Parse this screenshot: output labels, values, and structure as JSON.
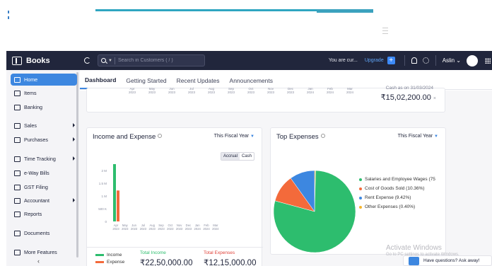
{
  "app": {
    "name": "Books"
  },
  "search": {
    "placeholder": "Search in Customers ( / )"
  },
  "header": {
    "org": "You are cur...",
    "upgrade": "Upgrade",
    "user": "Aslin",
    "user_caret": "⌄"
  },
  "sidebar": {
    "items": [
      {
        "label": "Home",
        "active": true
      },
      {
        "label": "Items"
      },
      {
        "label": "Banking"
      },
      {
        "label": "Sales",
        "has_submenu": true
      },
      {
        "label": "Purchases",
        "has_submenu": true
      },
      {
        "label": "Time Tracking",
        "has_submenu": true
      },
      {
        "label": "e-Way Bills"
      },
      {
        "label": "GST Filing"
      },
      {
        "label": "Accountant",
        "has_submenu": true
      },
      {
        "label": "Reports"
      },
      {
        "label": "Documents"
      },
      {
        "label": "More Features"
      }
    ],
    "collapse": "‹"
  },
  "tabs": [
    "Dashboard",
    "Getting Started",
    "Recent Updates",
    "Announcements"
  ],
  "cash_flow": {
    "months": [
      [
        "Apr",
        "2023"
      ],
      [
        "May",
        "2023"
      ],
      [
        "Jun",
        "2023"
      ],
      [
        "Jul",
        "2023"
      ],
      [
        "Aug",
        "2023"
      ],
      [
        "Sep",
        "2023"
      ],
      [
        "Oct",
        "2023"
      ],
      [
        "Nov",
        "2023"
      ],
      [
        "Dec",
        "2023"
      ],
      [
        "Jan",
        "2024"
      ],
      [
        "Feb",
        "2024"
      ],
      [
        "Mar",
        "2024"
      ]
    ],
    "cash_label": "Cash as on 31/03/2024",
    "cash_value": "₹15,02,200.00",
    "close": "×"
  },
  "income_expense": {
    "title": "Income and Expense",
    "period": "This Fiscal Year",
    "toggle": [
      "Accrual",
      "Cash"
    ],
    "legend": [
      {
        "label": "Income",
        "color": "#2dbd6e"
      },
      {
        "label": "Expense",
        "color": "#f36a3b"
      }
    ],
    "total_income_label": "Total Income",
    "total_income": "₹22,50,000.00",
    "total_expenses_label": "Total Expenses",
    "total_expenses": "₹12,15,000.00"
  },
  "chart_data": [
    {
      "type": "bar",
      "title": "Income and Expense",
      "categories": [
        "Apr 2023",
        "May 2023",
        "Jun 2023",
        "Jul 2023",
        "Aug 2023",
        "Sep 2023",
        "Oct 2023",
        "Nov 2023",
        "Dec 2023",
        "Jan 2024",
        "Feb 2024",
        "Mar 2024"
      ],
      "category_labels": [
        [
          "Apr",
          "2023"
        ],
        [
          "May",
          "2023"
        ],
        [
          "Jun",
          "2023"
        ],
        [
          "Jul",
          "2023"
        ],
        [
          "Aug",
          "2023"
        ],
        [
          "Sep",
          "2023"
        ],
        [
          "Oct",
          "2023"
        ],
        [
          "Nov",
          "2023"
        ],
        [
          "Dec",
          "2023"
        ],
        [
          "Jan",
          "2024"
        ],
        [
          "Feb",
          "2024"
        ],
        [
          "Mar",
          "2024"
        ]
      ],
      "series": [
        {
          "name": "Income",
          "color": "#2dbd6e",
          "values": [
            2250000,
            0,
            0,
            0,
            0,
            0,
            0,
            0,
            0,
            0,
            0,
            0
          ]
        },
        {
          "name": "Expense",
          "color": "#f36a3b",
          "values": [
            1215000,
            0,
            0,
            0,
            0,
            0,
            0,
            0,
            0,
            0,
            0,
            0
          ]
        }
      ],
      "yticks": [
        "0",
        "500 K",
        "1 M",
        "1.5 M",
        "2 M"
      ],
      "ylim": [
        0,
        2000000
      ]
    },
    {
      "type": "pie",
      "title": "Top Expenses",
      "slices": [
        {
          "label": "Salaries and Employee Wages (75",
          "value": 75,
          "color": "#2dbd6e"
        },
        {
          "label": "Cost of Goods Sold (10.36%)",
          "value": 10.36,
          "color": "#f36a3b"
        },
        {
          "label": "Rent Expense (9.42%)",
          "value": 9.42,
          "color": "#3d87e0"
        },
        {
          "label": "Other Expenses (0.40%)",
          "value": 0.4,
          "color": "#f5b52e"
        }
      ]
    }
  ],
  "top_expenses": {
    "title": "Top Expenses",
    "period": "This Fiscal Year"
  },
  "watermark": {
    "line1": "Activate Windows",
    "line2": "Go to PC settings to activate Windows."
  },
  "help": {
    "label": "Have questions? Ask away!"
  }
}
